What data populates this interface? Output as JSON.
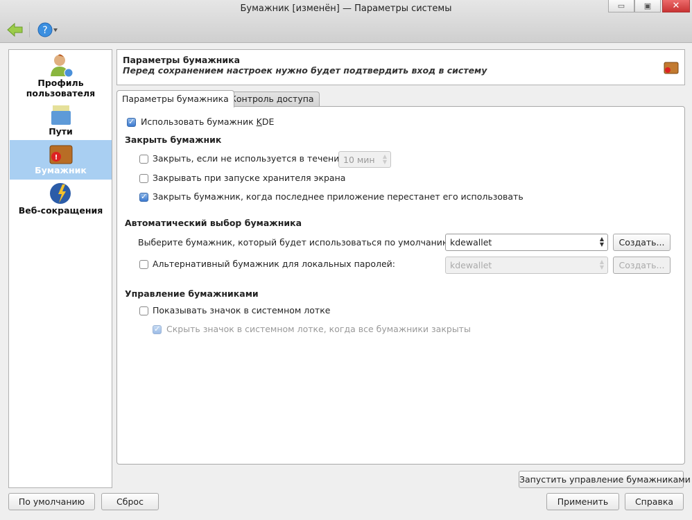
{
  "window": {
    "title": "Бумажник [изменён] — Параметры системы"
  },
  "toolbar": {
    "back_icon": "back-arrow-icon",
    "help_icon": "help-icon"
  },
  "sidebar": {
    "items": [
      {
        "label": "Профиль пользователя"
      },
      {
        "label": "Пути"
      },
      {
        "label": "Бумажник",
        "selected": true
      },
      {
        "label": "Веб-сокращения"
      }
    ]
  },
  "header": {
    "title": "Параметры бумажника",
    "subtitle": "Перед сохранением настроек нужно будет подтвердить вход в систему"
  },
  "tabs": [
    {
      "label": "Параметры бумажника",
      "active": true
    },
    {
      "label": "Контроль доступа"
    }
  ],
  "panel": {
    "use_kde_pre": "Использовать бумажник ",
    "use_kde_accel": "K",
    "use_kde_post": "DE",
    "close_heading": "Закрыть бумажник",
    "close_idle": "Закрыть, если не используется в течение:",
    "close_idle_value": "10 мин",
    "close_screensaver": "Закрывать при запуске хранителя экрана",
    "close_last_app": "Закрыть бумажник, когда последнее приложение перестанет его использовать",
    "auto_heading": "Автоматический выбор бумажника",
    "default_label": "Выберите бумажник, который будет использоваться по умолчанию:",
    "default_value": "kdewallet",
    "create_label": "Создать...",
    "alt_label": "Альтернативный бумажник для локальных паролей:",
    "alt_value": "kdewallet",
    "alt_create_label": "Создать...",
    "manage_heading": "Управление бумажниками",
    "show_tray": "Показывать значок в системном лотке",
    "hide_tray": "Скрыть значок в системном лотке, когда все бумажники закрыты"
  },
  "launch_manager": "Запустить управление бумажниками",
  "buttons": {
    "defaults": "По умолчанию",
    "reset": "Сброс",
    "apply": "Применить",
    "help": "Справка"
  }
}
